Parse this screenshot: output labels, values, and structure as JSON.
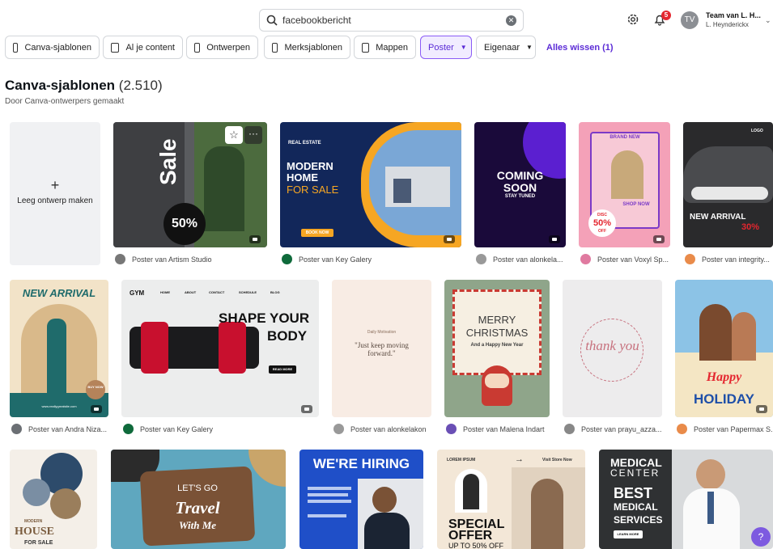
{
  "search": {
    "value": "facebookbericht"
  },
  "header": {
    "notifications": "5",
    "avatar_initials": "TV",
    "team": "Team van L. H...",
    "user": "L. Heynderickx"
  },
  "filters": [
    {
      "label": "Canva-sjablonen"
    },
    {
      "label": "Al je content"
    },
    {
      "label": "Ontwerpen"
    },
    {
      "label": "Merksjablonen"
    },
    {
      "label": "Mappen"
    },
    {
      "label": "Poster",
      "active": true
    },
    {
      "label": "Eigenaar"
    }
  ],
  "clear_all": "Alles wissen (1)",
  "section": {
    "title": "Canva-sjablonen",
    "count": "(2.510)",
    "subtitle": "Door Canva-ontwerpers gemaakt"
  },
  "blank": {
    "label": "Leeg ontwerp maken",
    "plus": "+"
  },
  "templates": {
    "t1": {
      "caption": "Poster van Artism Studio",
      "text_sale": "Sale",
      "text_pct": "50%"
    },
    "t2": {
      "caption": "Poster van Key Galery",
      "brand": "REAL ESTATE",
      "line1": "MODERN",
      "line2": "HOME",
      "line3": "FOR SALE",
      "cta": "BOOK NOW"
    },
    "t3": {
      "caption": "Poster van alonkela...",
      "line1": "COMING",
      "line2": "SOON",
      "line3": "STAY TUNED"
    },
    "t4": {
      "caption": "Poster van Voxyl Sp...",
      "top": "BRAND NEW",
      "pct": "50%",
      "shop": "SHOP NOW",
      "disc": "DISC",
      "off": "OFF"
    },
    "t5": {
      "caption": "Poster van integrity...",
      "line1": "NEW ARRIVAL",
      "pct": "30%",
      "logo": "LOGO"
    },
    "t6": {
      "caption": "Poster van Andra Niza...",
      "title": "NEW ARRIVAL",
      "buy": "BUY NOW",
      "url": "www.reallygreatsite.com"
    },
    "t7": {
      "caption": "Poster van Key Galery",
      "gym": "GYM",
      "nav": [
        "HOME",
        "ABOUT",
        "CONTACT",
        "SCHEDULE",
        "BLOG"
      ],
      "line1": "SHAPE YOUR",
      "line2": "BODY",
      "more": "READ MORE"
    },
    "t8": {
      "caption": "Poster van alonkelakon",
      "small": "Daily Motivation",
      "quote": "\"Just keep moving forward.\""
    },
    "t9": {
      "caption": "Poster van Malena Indart",
      "line1": "MERRY",
      "line2": "CHRISTMAS",
      "line3": "And a Happy New Year"
    },
    "t10": {
      "caption": "Poster van prayu_azza...",
      "script": "thank you"
    },
    "t11": {
      "caption": "Poster van Papermax S...",
      "line1": "Happy",
      "line2": "HOLIDAY"
    },
    "t12": {
      "line1": "HOUSE",
      "line2": "FOR SALE",
      "modern": "MODERN"
    },
    "t13": {
      "line1": "LET'S GO",
      "line2": "Travel",
      "line3": "With Me"
    },
    "t14": {
      "line1": "WE'RE HIRING"
    },
    "t15": {
      "brand": "LOREM IPSUM",
      "visit": "Visit Store Now",
      "line1": "SPECIAL",
      "line2": "OFFER",
      "line3": "UP TO 50% OFF"
    },
    "t16": {
      "line1": "MEDICAL",
      "line2": "CENTER",
      "line3": "BEST",
      "line4": "MEDICAL",
      "line5": "SERVICES",
      "cta": "LEARN MORE"
    }
  },
  "help": "?"
}
